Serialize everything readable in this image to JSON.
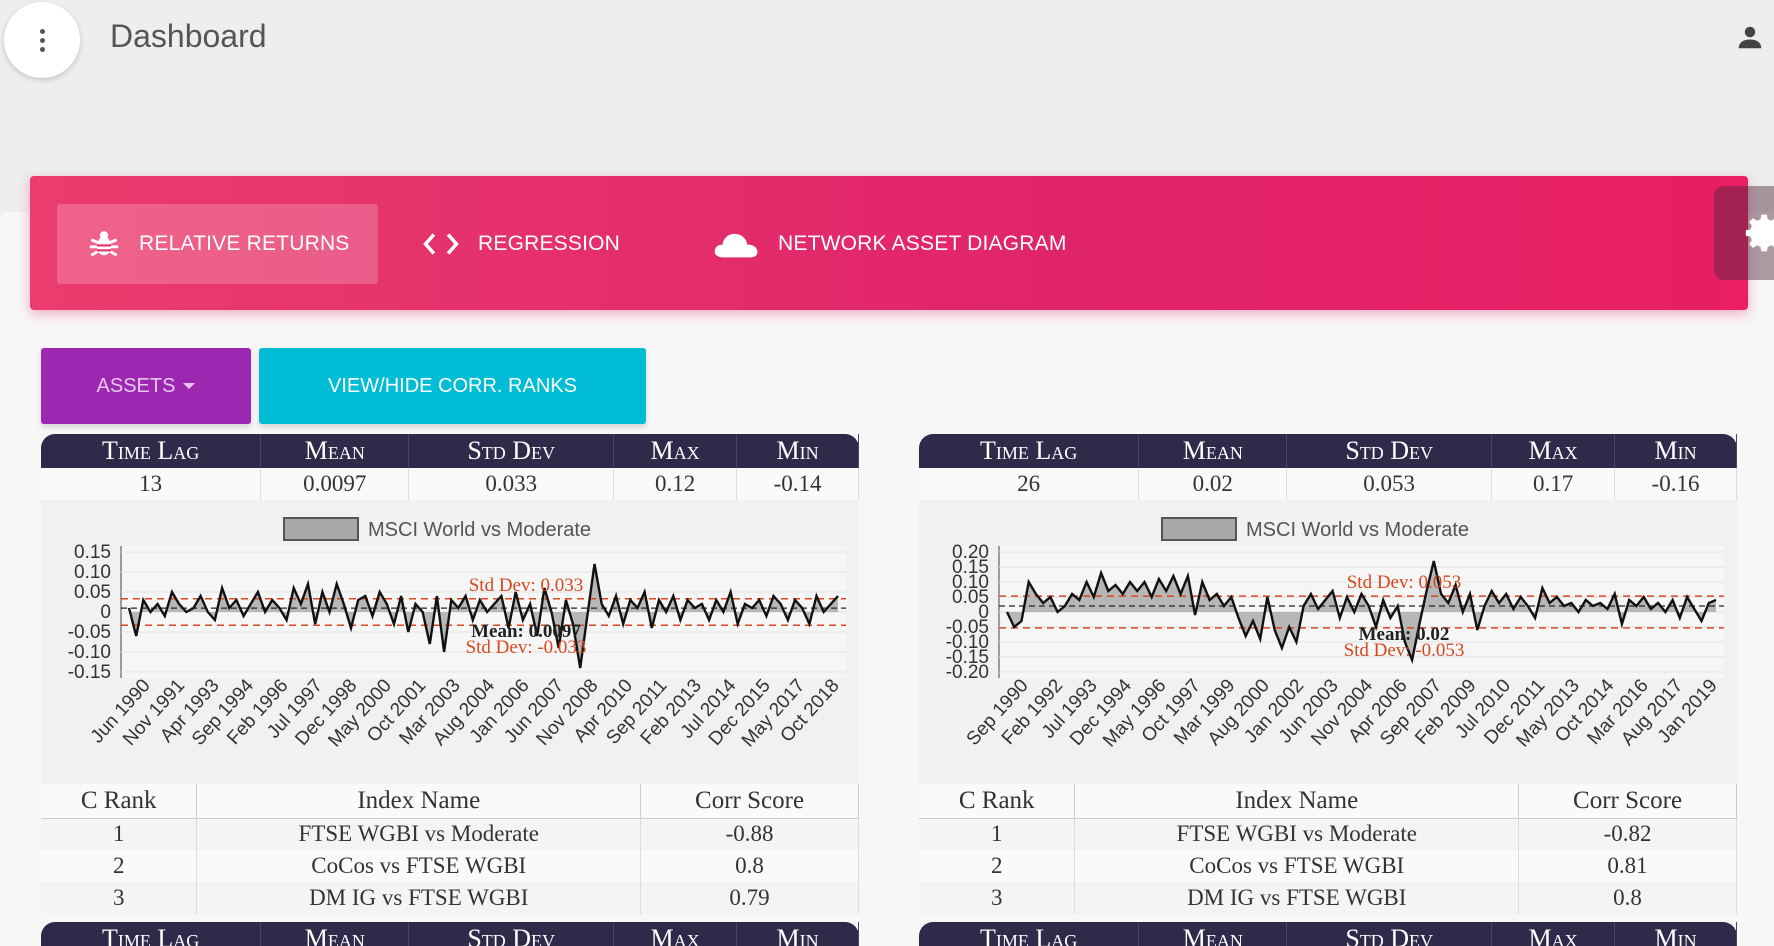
{
  "header": {
    "title": "Dashboard"
  },
  "tabs": [
    {
      "label": "RELATIVE RETURNS",
      "icon": "bug-icon",
      "active": true
    },
    {
      "label": "REGRESSION",
      "icon": "code-icon",
      "active": false
    },
    {
      "label": "NETWORK ASSET DIAGRAM",
      "icon": "cloud-icon",
      "active": false
    }
  ],
  "buttons": {
    "assets": "ASSETS",
    "corr": "VIEW/HIDE CORR. RANKS"
  },
  "colors": {
    "tabbar": "#e91e63",
    "assets": "#9c27b0",
    "corr": "#00bcd4",
    "table_header": "#2f2a4a",
    "reference_line": "#d9471f"
  },
  "stats_headers": [
    "Time Lag",
    "Mean",
    "Std Dev",
    "Max",
    "Min"
  ],
  "rank_headers": [
    "C Rank",
    "Index Name",
    "Corr Score"
  ],
  "panels": [
    {
      "stats": {
        "lag": "13",
        "mean": "0.0097",
        "std": "0.033",
        "max": "0.12",
        "min": "-0.14"
      },
      "ranks": [
        {
          "rank": "1",
          "name": "FTSE WGBI vs Moderate",
          "score": "-0.88"
        },
        {
          "rank": "2",
          "name": "CoCos vs FTSE WGBI",
          "score": "0.8"
        },
        {
          "rank": "3",
          "name": "DM IG vs FTSE WGBI",
          "score": "0.79"
        }
      ]
    },
    {
      "stats": {
        "lag": "26",
        "mean": "0.02",
        "std": "0.053",
        "max": "0.17",
        "min": "-0.16"
      },
      "ranks": [
        {
          "rank": "1",
          "name": "FTSE WGBI vs Moderate",
          "score": "-0.82"
        },
        {
          "rank": "2",
          "name": "CoCos vs FTSE WGBI",
          "score": "0.81"
        },
        {
          "rank": "3",
          "name": "DM IG vs FTSE WGBI",
          "score": "0.8"
        }
      ]
    }
  ],
  "chart_data": [
    {
      "type": "area",
      "legend": "MSCI World vs Moderate",
      "ylim": [
        -0.15,
        0.15
      ],
      "yticks": [
        "0.15",
        "0.10",
        "0.05",
        "0",
        "-0.05",
        "-0.10",
        "-0.15"
      ],
      "xticks": [
        "Jun 1990",
        "Nov 1991",
        "Apr 1993",
        "Sep 1994",
        "Feb 1996",
        "Jul 1997",
        "Dec 1998",
        "May 2000",
        "Oct 2001",
        "Mar 2003",
        "Aug 2004",
        "Jan 2006",
        "Jun 2007",
        "Nov 2008",
        "Apr 2010",
        "Sep 2011",
        "Feb 2013",
        "Jul 2014",
        "Dec 2015",
        "May 2017",
        "Oct 2018"
      ],
      "annotations": {
        "std_pos": "Std Dev: 0.033",
        "std_neg": "Std Dev: -0.033",
        "mean": "Mean: 0.0097"
      },
      "mean": 0.0097,
      "std": 0.033,
      "values": [
        0.01,
        -0.06,
        0.03,
        0.0,
        0.02,
        -0.01,
        0.05,
        0.02,
        0.0,
        0.01,
        0.04,
        0.0,
        -0.02,
        0.06,
        0.01,
        0.03,
        -0.01,
        0.02,
        0.05,
        0.0,
        0.03,
        0.01,
        -0.02,
        0.06,
        0.02,
        0.07,
        -0.03,
        0.05,
        0.0,
        0.07,
        0.02,
        -0.04,
        0.03,
        0.04,
        -0.01,
        0.05,
        0.02,
        -0.03,
        0.04,
        -0.05,
        0.02,
        0.0,
        -0.08,
        0.04,
        -0.1,
        0.03,
        0.01,
        0.04,
        -0.02,
        0.03,
        0.0,
        0.02,
        0.04,
        -0.04,
        0.05,
        -0.02,
        0.02,
        -0.06,
        0.06,
        0.0,
        -0.09,
        0.03,
        -0.03,
        -0.14,
        -0.01,
        0.12,
        0.02,
        -0.01,
        0.04,
        -0.03,
        0.03,
        0.01,
        0.05,
        -0.04,
        0.03,
        0.0,
        0.04,
        -0.02,
        0.03,
        0.01,
        0.02,
        -0.02,
        0.03,
        0.0,
        0.05,
        -0.03,
        0.02,
        0.01,
        0.03,
        -0.01,
        0.04,
        0.02,
        -0.02,
        0.03,
        0.01,
        -0.03,
        0.04,
        0.0,
        0.02,
        0.04
      ]
    },
    {
      "type": "area",
      "legend": "MSCI World vs Moderate",
      "ylim": [
        -0.2,
        0.2
      ],
      "yticks": [
        "0.20",
        "0.15",
        "0.10",
        "0.05",
        "0",
        "-0.05",
        "-0.10",
        "-0.15",
        "-0.20"
      ],
      "xticks": [
        "Sep 1990",
        "Feb 1992",
        "Jul 1993",
        "Dec 1994",
        "May 1996",
        "Oct 1997",
        "Mar 1999",
        "Aug 2000",
        "Jan 2002",
        "Jun 2003",
        "Nov 2004",
        "Apr 2006",
        "Sep 2007",
        "Feb 2009",
        "Jul 2010",
        "Dec 2011",
        "May 2013",
        "Oct 2014",
        "Mar 2016",
        "Aug 2017",
        "Jan 2019"
      ],
      "annotations": {
        "std_pos": "Std Dev: 0.053",
        "std_neg": "Std Dev: -0.053",
        "mean": "Mean: 0.02"
      },
      "mean": 0.02,
      "std": 0.053,
      "values": [
        0.0,
        -0.05,
        -0.03,
        0.1,
        0.06,
        0.03,
        0.05,
        0.0,
        0.02,
        0.06,
        0.04,
        0.1,
        0.05,
        0.13,
        0.07,
        0.09,
        0.06,
        0.1,
        0.07,
        0.1,
        0.05,
        0.11,
        0.07,
        0.12,
        0.06,
        0.12,
        -0.01,
        0.1,
        0.04,
        0.06,
        0.02,
        0.05,
        -0.02,
        -0.08,
        -0.03,
        -0.09,
        0.05,
        -0.06,
        -0.12,
        -0.05,
        -0.1,
        0.02,
        0.06,
        0.01,
        0.04,
        0.07,
        -0.02,
        0.05,
        0.0,
        0.06,
        0.02,
        -0.05,
        0.04,
        -0.02,
        0.02,
        -0.1,
        -0.16,
        -0.04,
        0.07,
        0.17,
        0.06,
        0.03,
        0.09,
        0.0,
        0.06,
        -0.06,
        0.02,
        0.07,
        0.03,
        0.06,
        0.01,
        0.05,
        0.02,
        -0.02,
        0.08,
        0.03,
        0.05,
        0.02,
        0.03,
        0.0,
        0.04,
        0.02,
        0.03,
        0.01,
        0.06,
        -0.04,
        0.04,
        0.02,
        0.05,
        0.01,
        0.03,
        0.0,
        0.04,
        -0.02,
        0.05,
        0.01,
        -0.03,
        0.03,
        0.04
      ]
    }
  ]
}
